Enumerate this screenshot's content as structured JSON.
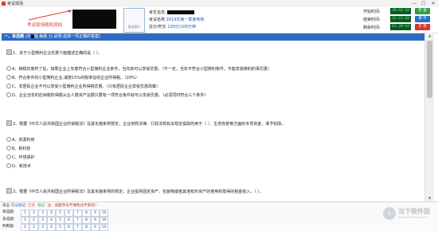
{
  "window": {
    "title": "考试现场",
    "minimize": "—",
    "maximize": "☐",
    "close": "✕"
  },
  "header": {
    "snapshot_note": "考试现场随机抓拍",
    "photo_label": "暂无照片",
    "candidate_label": "考生信息:",
    "exam_name_label": "考试名称",
    "exam_name_value": "2019年第一季度考核",
    "score_label": "总分/时长",
    "score_value": "100分/100分钟",
    "start_label": "开始时间:",
    "start_time": "20:43:10",
    "end_label": "结束时间:",
    "end_time": "22:23:10",
    "remaining_label": "剩余时间:",
    "remaining_time": "01:39:54",
    "btn_check": "检 查",
    "btn_save": "保 存",
    "btn_submit": "交 卷",
    "colors": {
      "check": "#2e9e47",
      "save": "#2b6cc4",
      "submit": "#d8352a"
    }
  },
  "section": {
    "title": "一、单选题",
    "desc_pre": "(共",
    "desc_post": "题,每题 分,说明:选择一项正确的答案)"
  },
  "questions": [
    {
      "text": "1、关于小型微利企业优惠下面描述正确的是（  ）。",
      "options": [
        "A、纳税年度终了后，如果企业上年度符合小型微利企业条件，当年就可以享受优惠。（不一定，当年不符合小型微利条件，不能享受微利的事优惠）",
        "B、符合条件的小型微利企业,减按15%的税率征收企业所得税。（20%）",
        "C、非居民企业不可以享受小型微利企业所得税优惠。（只有居民企业享受优惠政策）",
        "D、企业当年的应纳税所得额从业人数资产总额只要有一项符合条件就可以享受优惠。（必须同时符合三个条件）"
      ]
    },
    {
      "text": "2、根据《中华人民共和国企业所得税法》及其实施条例规定，企业依照法律、行政法规有关规定提取的用于（  ）、生态恢复等方面的专项资金，准予扣除。",
      "options": [
        "A、资源利用",
        "B、新科技",
        "C、环境保护",
        "D、新技术"
      ]
    },
    {
      "text": "3、根据《中华人民共和国企业所得税法》及其实施条例的规定，企业提供固定资产、包装物或者其他有形资产的使用权取得的租金收入，（  ）。",
      "options": []
    }
  ],
  "footer": {
    "legend": {
      "prefix": "单击",
      "current_label": "可以标记",
      "current_color": "#1f56b8",
      "answered_label": "已答",
      "answered_color": "#e05a2a",
      "flagged_label": "标记",
      "flagged_color": "#2a9a3a",
      "note": "注：试题序号不填色也不影响！"
    },
    "rows": [
      {
        "label": "单选题:",
        "numbers": [
          "1",
          "2",
          "3",
          "4",
          "5",
          "6",
          "7",
          "8",
          "9",
          "10"
        ]
      },
      {
        "label": "多选题:",
        "numbers": [
          "1",
          "2",
          "3",
          "4",
          "5",
          "6",
          "7",
          "8",
          "9",
          "10"
        ]
      },
      {
        "label": "判断题:",
        "numbers": [
          "1",
          "2",
          "3",
          "4",
          "5",
          "6",
          "7",
          "8",
          "9",
          "10"
        ]
      }
    ]
  },
  "watermark": {
    "text": "当下软件园",
    "sub": "www.downxia.com",
    "symbol": "↓"
  }
}
